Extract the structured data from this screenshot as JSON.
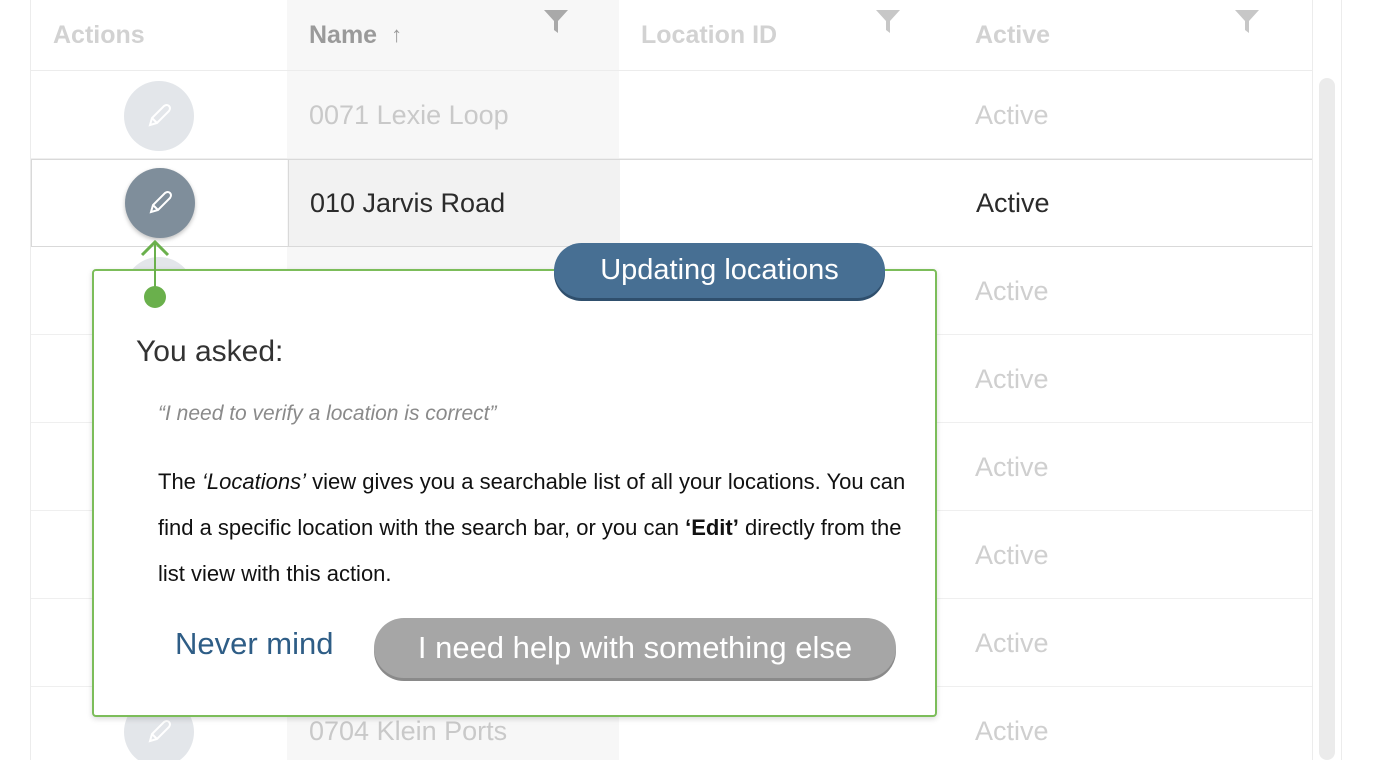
{
  "grid": {
    "columns": {
      "actions": "Actions",
      "name": "Name",
      "location_id": "Location ID",
      "active": "Active"
    },
    "sort_indicator": "↑",
    "rows": [
      {
        "name": "0071 Lexie Loop",
        "location_id": "",
        "active": "Active"
      },
      {
        "name": "010 Jarvis Road",
        "location_id": "",
        "active": "Active",
        "selected": true
      },
      {
        "name": "",
        "location_id": "",
        "active": "Active"
      },
      {
        "name": "",
        "location_id": "",
        "active": "Active"
      },
      {
        "name": "",
        "location_id": "",
        "active": "Active"
      },
      {
        "name": "",
        "location_id": "",
        "active": "Active"
      },
      {
        "name": "",
        "location_id": "",
        "active": "Active"
      },
      {
        "name": "0704 Klein Ports",
        "location_id": "",
        "active": "Active"
      }
    ]
  },
  "popup": {
    "tag": "Updating locations",
    "you_asked": "You asked:",
    "quote": "“I need to verify a location is correct”",
    "body": {
      "part1": "The ",
      "locations_em": "‘Locations’",
      "part2": " view gives you a searchable list of all your locations. You can find a specific location with the search bar, or you can ",
      "edit_strong": "‘Edit’",
      "part3": " directly from the list view with this action."
    },
    "never_mind": "Never mind",
    "help_button": "I need help with something else"
  },
  "colors": {
    "accent_blue": "#476f93",
    "link_blue": "#2e5d86",
    "pointer_green": "#6ab04c",
    "button_gray": "#a6a6a6"
  }
}
